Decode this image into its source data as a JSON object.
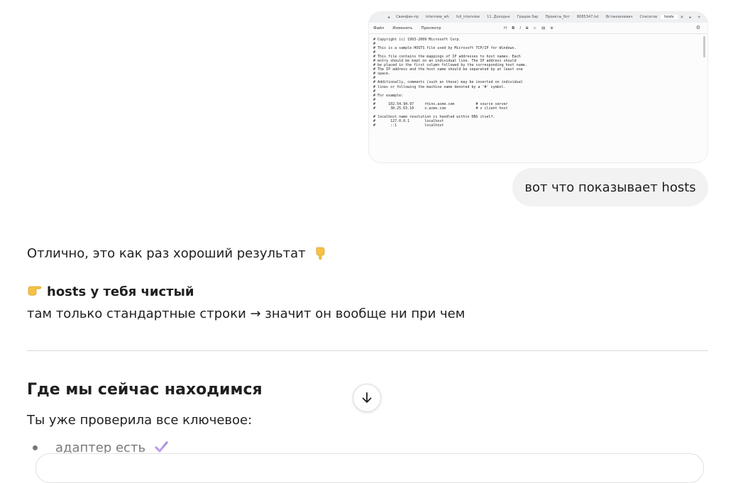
{
  "thumbnail": {
    "tabs": [
      "Свинфан-пр",
      "interview_wh",
      "full_interview",
      "11. Доходна",
      "Градов-Зар",
      "Проекты_бот",
      "8085347.txt",
      "Встановлювач",
      "Спасатов",
      "hosts"
    ],
    "active_tab_close": "✕",
    "new_tab": "+",
    "menu": [
      "Файл",
      "Изменить",
      "Просмотр"
    ],
    "tool_labels": [
      "H",
      "B",
      "I",
      "S",
      "⊂",
      "▤",
      "⊕"
    ],
    "lines": [
      "# Copyright (c) 1993-2009 Microsoft Corp.",
      "#",
      "# This is a sample HOSTS file used by Microsoft TCP/IP for Windows.",
      "#",
      "# This file contains the mappings of IP addresses to host names. Each",
      "# entry should be kept on an individual line. The IP address should",
      "# be placed in the first column followed by the corresponding host name.",
      "# The IP address and the host name should be separated by at least one",
      "# space.",
      "#",
      "# Additionally, comments (such as these) may be inserted on individual",
      "# lines or following the machine name denoted by a '#' symbol.",
      "#",
      "# For example:",
      "#",
      "#      102.54.94.97     rhino.acme.com          # source server",
      "#       38.25.63.10     x.acme.com              # x client host",
      "",
      "# localhost name resolution is handled within DNS itself.",
      "#\t127.0.0.1       localhost",
      "#\t::1             localhost"
    ]
  },
  "user_message": "вот что показывает hosts",
  "assistant": {
    "line1": "Отлично, это как раз хороший результат",
    "line2": "hosts у тебя чистый",
    "line3": "там только стандартные строки → значит он вообще ни при чем",
    "heading": "Где мы сейчас находимся",
    "line4": "Ты уже проверила все ключевое:",
    "bullets": [
      "адаптер есть"
    ]
  },
  "icons": {
    "line1_emoji": "hand-pointing-down-icon",
    "line2_emoji": "hand-pointing-right-icon",
    "bullet_emoji": "check-mark-icon",
    "scroll": "arrow-down-icon"
  },
  "colors": {
    "bubble_bg": "#f2f2f2",
    "text": "#1f1f1f",
    "check": "#8a5cd6",
    "emoji_skin": "#f6c143"
  }
}
